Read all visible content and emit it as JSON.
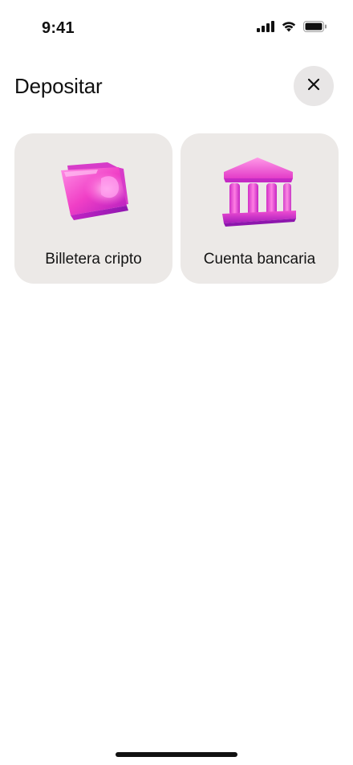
{
  "status_bar": {
    "time": "9:41",
    "icons": [
      "cellular-signal-icon",
      "wifi-icon",
      "battery-icon"
    ]
  },
  "header": {
    "title": "Depositar",
    "close_icon": "close-icon"
  },
  "options": [
    {
      "label": "Billetera cripto",
      "icon": "wallet-icon"
    },
    {
      "label": "Cuenta bancaria",
      "icon": "bank-icon"
    }
  ],
  "colors": {
    "card_background": "#ece9e7",
    "close_button_background": "#e8e6e6",
    "accent_pink": "#f046c8",
    "accent_magenta": "#c21ec6"
  }
}
